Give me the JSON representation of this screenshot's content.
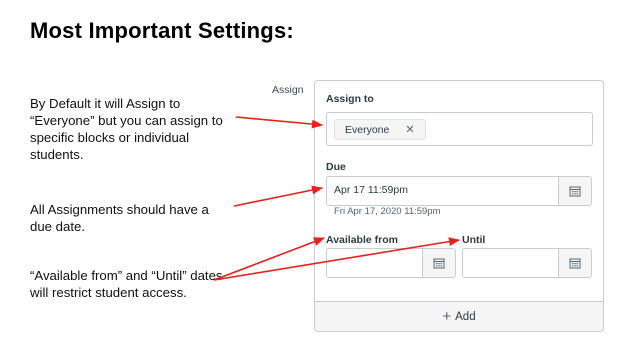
{
  "slide": {
    "title": "Most Important Settings:",
    "notes": [
      "By Default it will Assign to “Everyone” but you can assign to specific blocks or individual students.",
      "All Assignments should have a due date.",
      "“Available from” and “Until” dates will restrict student access."
    ]
  },
  "form": {
    "section_label": "Assign",
    "assign_to_label": "Assign to",
    "assignee_chip": "Everyone",
    "assignee_remove_icon": "close-icon",
    "due_label": "Due",
    "due_value": "Apr 17 11:59pm",
    "due_hint": "Fri Apr 17, 2020 11:59pm",
    "available_from_label": "Available from",
    "available_from_value": "",
    "until_label": "Until",
    "until_value": "",
    "calendar_icon": "calendar-icon",
    "add_label": "Add",
    "add_icon": "plus-icon"
  },
  "colors": {
    "arrow": "#e8221b",
    "border": "#c7cdd1",
    "text": "#2d3b45"
  }
}
